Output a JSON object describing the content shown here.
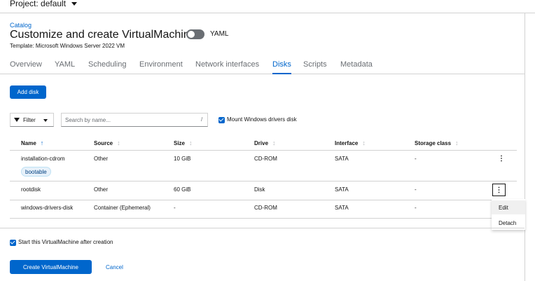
{
  "project": {
    "label": "Project: default"
  },
  "breadcrumb": "Catalog",
  "page_title": "Customize and create VirtualMachine",
  "yaml_toggle": {
    "label": "YAML",
    "on": false
  },
  "template_text": "Template: Microsoft Windows Server 2022 VM",
  "tabs": [
    {
      "label": "Overview",
      "active": false
    },
    {
      "label": "YAML",
      "active": false
    },
    {
      "label": "Scheduling",
      "active": false
    },
    {
      "label": "Environment",
      "active": false
    },
    {
      "label": "Network interfaces",
      "active": false
    },
    {
      "label": "Disks",
      "active": true
    },
    {
      "label": "Scripts",
      "active": false
    },
    {
      "label": "Metadata",
      "active": false
    }
  ],
  "add_disk_label": "Add disk",
  "toolbar": {
    "filter_label": "Filter",
    "search_placeholder": "Search by name...",
    "search_shortcut": "/",
    "mount_drivers_label": "Mount Windows drivers disk",
    "mount_drivers_checked": true
  },
  "table": {
    "columns": [
      "Name",
      "Source",
      "Size",
      "Drive",
      "Interface",
      "Storage class"
    ],
    "sorted_by": "Name",
    "rows": [
      {
        "name": "installation-cdrom",
        "badge": "bootable",
        "source": "Other",
        "size": "10 GiB",
        "drive": "CD-ROM",
        "interface": "SATA",
        "storage_class": "-"
      },
      {
        "name": "rootdisk",
        "source": "Other",
        "size": "60 GiB",
        "drive": "Disk",
        "interface": "SATA",
        "storage_class": "-"
      },
      {
        "name": "windows-drivers-disk",
        "source": "Container (Ephemeral)",
        "size": "-",
        "drive": "CD-ROM",
        "interface": "SATA",
        "storage_class": "-"
      }
    ]
  },
  "row_menu": {
    "items": [
      "Edit",
      "Detach"
    ]
  },
  "footer": {
    "start_label": "Start this VirtualMachine after creation",
    "start_checked": true,
    "create_label": "Create VirtualMachine",
    "cancel_label": "Cancel"
  },
  "colors": {
    "primary": "#0066cc",
    "border": "#d2d2d2",
    "text": "#151515",
    "muted": "#6a6e73"
  }
}
